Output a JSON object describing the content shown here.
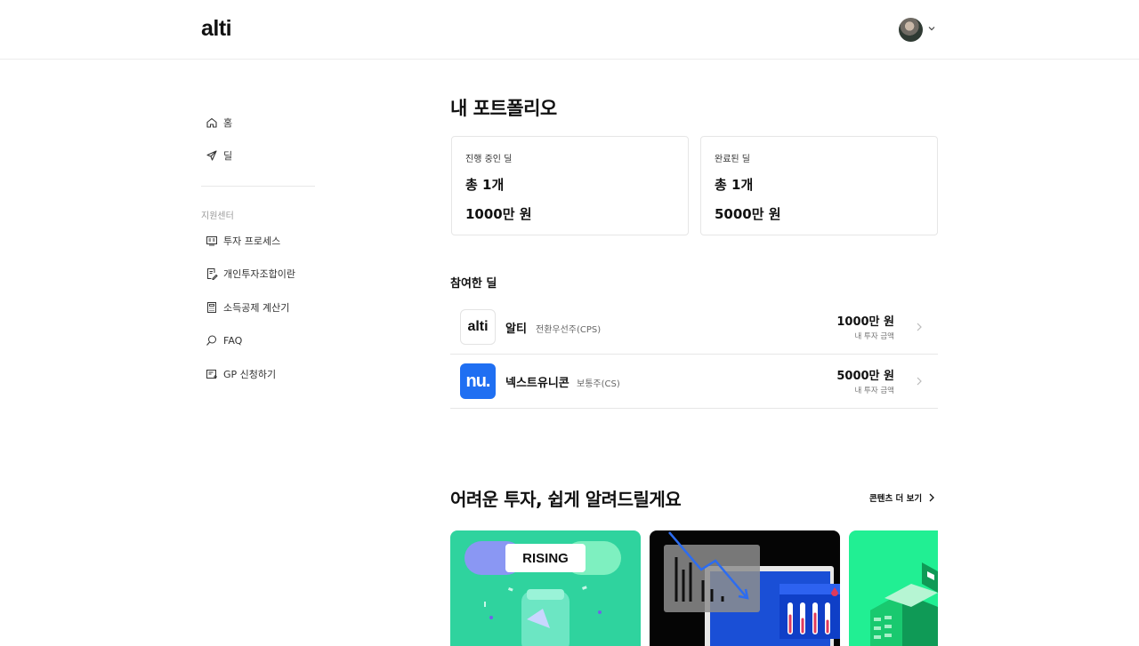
{
  "header": {
    "logo": "alti"
  },
  "sidebar": {
    "items": [
      {
        "label": "홈",
        "icon": "home-icon"
      },
      {
        "label": "딜",
        "icon": "rocket-icon"
      }
    ],
    "section_title": "지원센터",
    "support_items": [
      {
        "label": "투자 프로세스",
        "icon": "process-icon"
      },
      {
        "label": "개인투자조합이란",
        "icon": "document-edit-icon"
      },
      {
        "label": "소득공제 계산기",
        "icon": "calculator-icon"
      },
      {
        "label": "FAQ",
        "icon": "search-icon"
      },
      {
        "label": "GP 신청하기",
        "icon": "apply-icon"
      }
    ]
  },
  "portfolio": {
    "title": "내 포트폴리오",
    "cards": [
      {
        "label": "진행 중인 딜",
        "count": "총 1개",
        "amount": "1000만 원"
      },
      {
        "label": "완료된 딜",
        "count": "총 1개",
        "amount": "5000만 원"
      }
    ]
  },
  "deals": {
    "title": "참여한 딜",
    "items": [
      {
        "logo": "alti",
        "name": "알티",
        "type": "전환우선주(CPS)",
        "amount": "1000만 원",
        "amount_label": "내 투자 금액"
      },
      {
        "logo": "nu.",
        "name": "넥스트유니콘",
        "type": "보통주(CS)",
        "amount": "5000만 원",
        "amount_label": "내 투자 금액"
      }
    ]
  },
  "content": {
    "title": "어려운 투자, 쉽게 알려드릴게요",
    "more_label": "콘텐츠 더 보기",
    "cards": [
      {
        "badge": "RISING"
      },
      {
        "badge": ""
      },
      {
        "badge": ""
      }
    ]
  },
  "colors": {
    "nu_blue": "#1f6ff2",
    "card_green": "#2fd39e",
    "card_bright_green": "#21ef93"
  }
}
